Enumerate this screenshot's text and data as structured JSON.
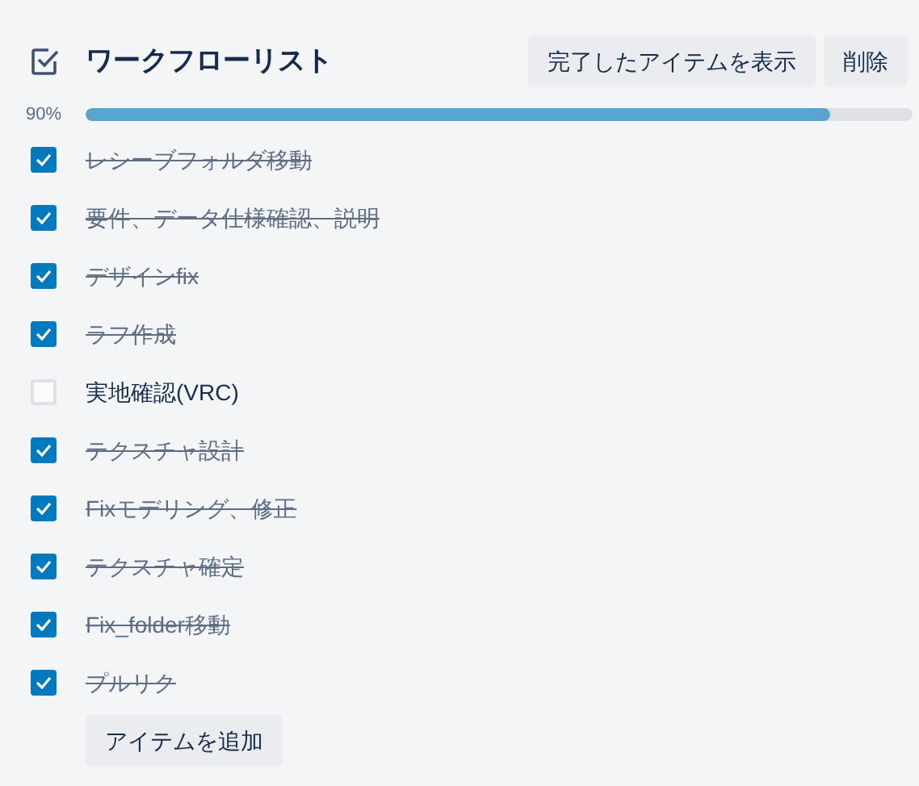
{
  "checklist": {
    "title": "ワークフローリスト",
    "buttons": [
      "完了したアイテムを表示",
      "削除"
    ],
    "progress": {
      "label": "90%",
      "level": 0.9
    },
    "items": [
      {
        "text": "レシーブフォルダ移動",
        "checked": true
      },
      {
        "text": "要件、データ仕様確認、説明",
        "checked": true
      },
      {
        "text": "デザインfix",
        "checked": true
      },
      {
        "text": "ラフ作成",
        "checked": true
      },
      {
        "text": "実地確認(VRC)",
        "checked": false
      },
      {
        "text": "テクスチャ設計",
        "checked": true
      },
      {
        "text": "Fixモデリング、修正",
        "checked": true
      },
      {
        "text": "テクスチャ確定",
        "checked": true
      },
      {
        "text": "Fix_folder移動",
        "checked": true
      },
      {
        "text": "プルリク",
        "checked": true
      }
    ],
    "add_button": "アイテムを追加"
  }
}
